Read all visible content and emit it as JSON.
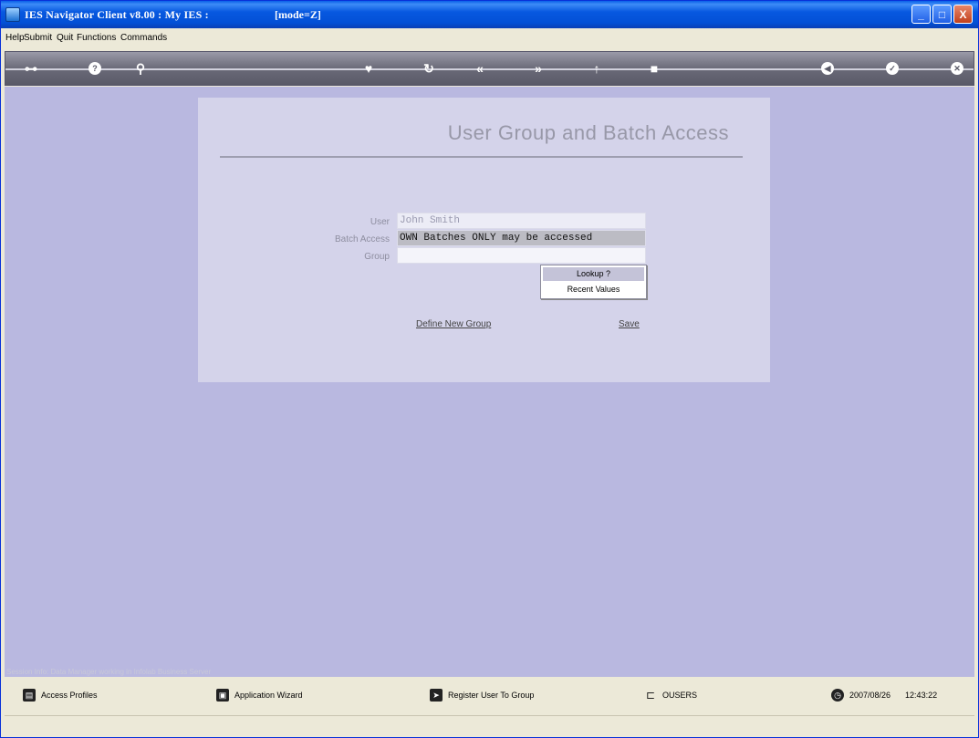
{
  "window": {
    "title": "IES Navigator Client v8.00 : My IES :",
    "mode": "[mode=Z]",
    "controls": {
      "minimize": "_",
      "maximize": "□",
      "close": "X"
    }
  },
  "menu": [
    "Help",
    "Submit",
    "Quit",
    "Functions",
    "Commands"
  ],
  "toolbar": {
    "icons": [
      "key-icon",
      "help-icon",
      "search-icon",
      "heart-icon",
      "refresh-icon",
      "rewind-icon",
      "forward-icon",
      "up-icon",
      "square-icon",
      "back-icon",
      "check-icon",
      "close-icon"
    ]
  },
  "form": {
    "title": "User Group and Batch Access",
    "user_label": "User",
    "user_value": "John Smith",
    "batch_label": "Batch Access",
    "batch_value": "OWN Batches ONLY may be accessed",
    "group_label": "Group",
    "group_value": "",
    "popup": [
      "Lookup ?",
      "Recent Values"
    ],
    "define_link": "Define New Group",
    "save_link": "Save"
  },
  "status": {
    "session_text": "Session Info: Data Manager working in Infolab Business Server",
    "items": [
      "Access Profiles",
      "Application Wizard",
      "Register User To Group",
      "OUSERS"
    ],
    "date": "2007/08/26",
    "time": "12:43:22"
  },
  "colors": {
    "title_bar": "#0350d6",
    "background": "#b9b8e0",
    "panel": "#d4d3ea",
    "toolbar": "#6a6a78"
  }
}
